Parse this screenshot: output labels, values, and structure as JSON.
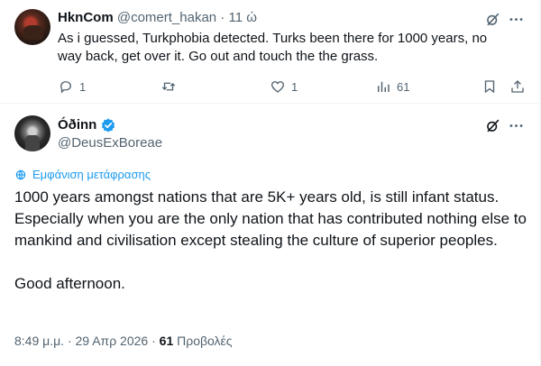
{
  "reply": {
    "display_name": "HknCom",
    "handle": "@comert_hakan",
    "separator": "·",
    "time_ago": "11 ώ",
    "text": "As i guessed, Turkphobia detected. Turks been there for 1000 years, no way back, get over it. Go out and touch the the grass.",
    "actions": {
      "replies": "1",
      "retweets": "",
      "likes": "1",
      "views": "61"
    }
  },
  "tweet": {
    "display_name": "Óðinn",
    "handle": "@DeusExBoreae",
    "translate_label": "Εμφάνιση μετάφρασης",
    "paragraph_1": "1000 years amongst nations that are 5K+ years old, is still infant status. Especially when you are the only nation that has contributed nothing else to mankind and civilisation except stealing the culture of superior peoples.",
    "paragraph_2": "Good afternoon.",
    "time": "8:49 μ.μ.",
    "date": "29 Απρ 2026",
    "separator": "·",
    "views_count": "61",
    "views_label": "Προβολές"
  },
  "colors": {
    "accent": "#1d9bf0",
    "text_primary": "#0f1419",
    "text_secondary": "#536471",
    "border": "#eff3f4"
  },
  "icons": {
    "grok": "grok-icon",
    "more": "more-icon",
    "reply": "reply-icon",
    "retweet": "retweet-icon",
    "like": "like-icon",
    "views": "views-icon",
    "bookmark": "bookmark-icon",
    "share": "share-icon",
    "verified": "verified-badge-icon",
    "translate": "translate-icon"
  }
}
